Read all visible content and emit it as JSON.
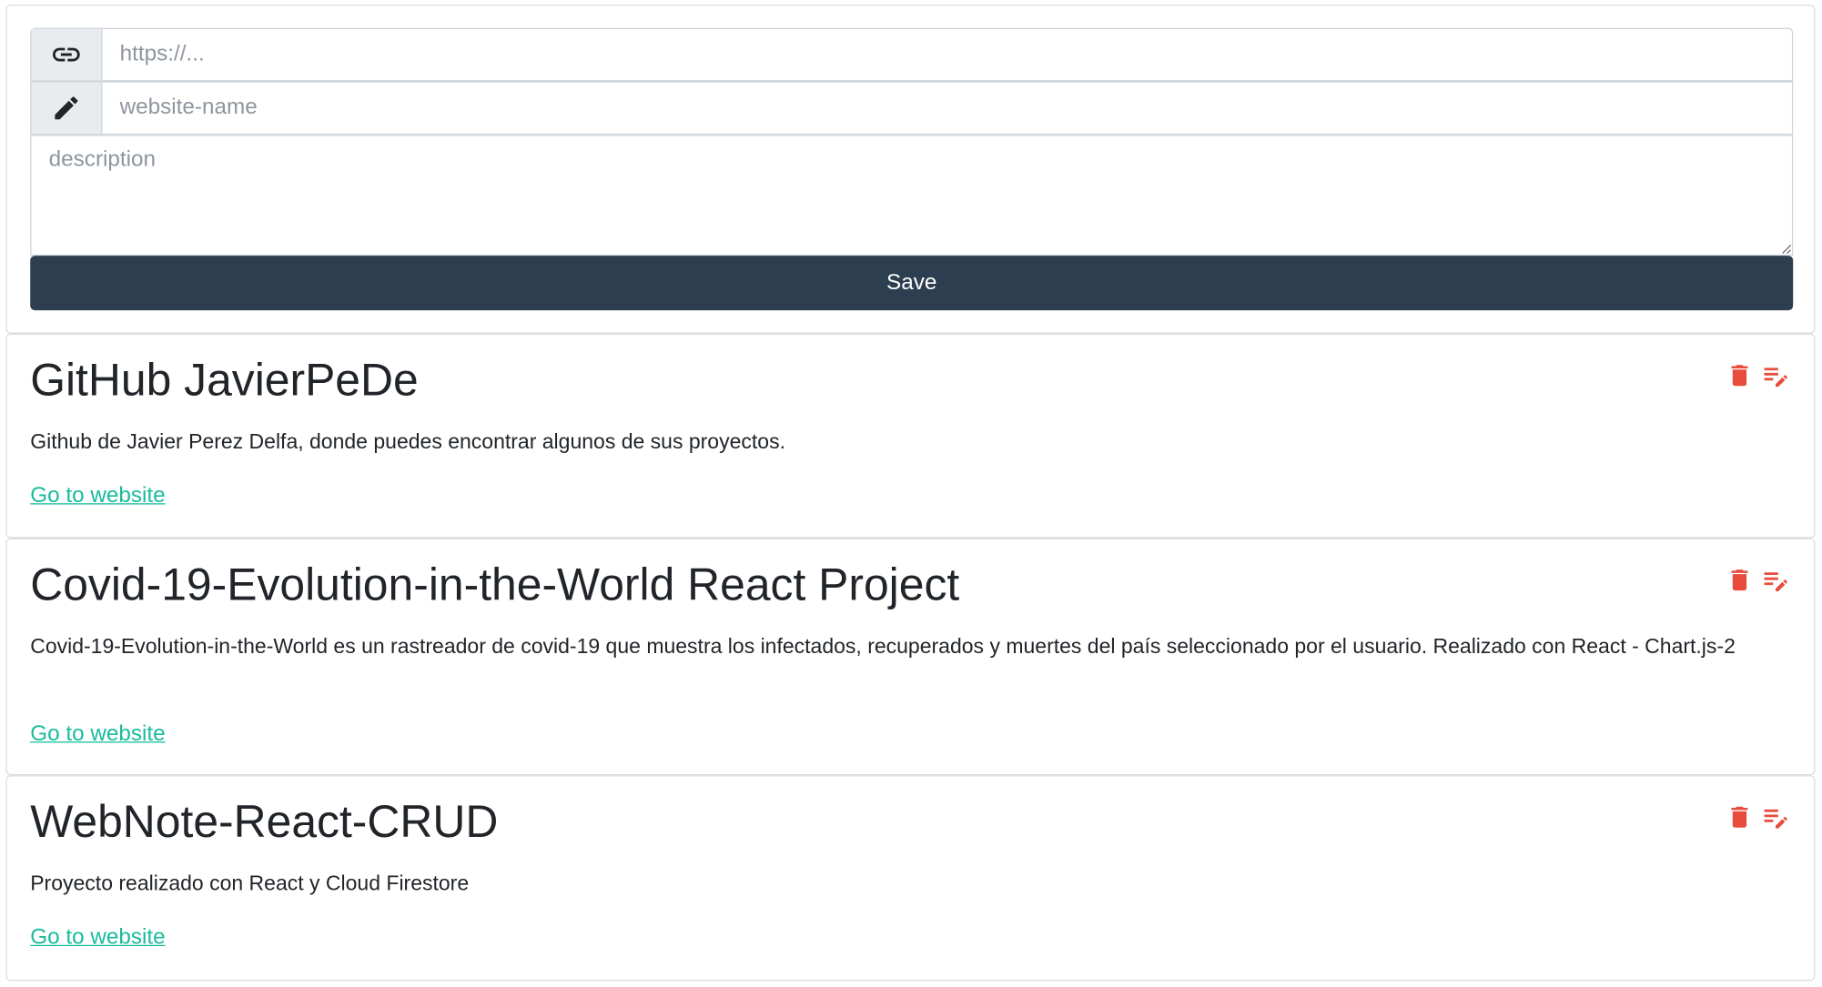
{
  "form": {
    "url_placeholder": "https://...",
    "name_placeholder": "website-name",
    "description_placeholder": "description",
    "save_label": "Save",
    "link_icon": "link-icon",
    "name_icon": "pencil-icon"
  },
  "colors": {
    "primary": "#2c3e50",
    "link": "#18bc9c",
    "danger": "#e74c3c"
  },
  "links": [
    {
      "title": "GitHub JavierPeDe",
      "description": "Github de Javier Perez Delfa, donde puedes encontrar algunos de sus proyectos.",
      "link_label": "Go to website"
    },
    {
      "title": "Covid-19-Evolution-in-the-World React Project",
      "description": "Covid-19-Evolution-in-the-World es un rastreador de covid-19 que muestra los infectados, recuperados y muertes del país seleccionado por el usuario. Realizado con React - Chart.js-2",
      "link_label": "Go to website"
    },
    {
      "title": "WebNote-React-CRUD",
      "description": "Proyecto realizado con React y Cloud Firestore",
      "link_label": "Go to website"
    }
  ],
  "icons": {
    "delete": "trash-icon",
    "edit": "edit-icon"
  }
}
